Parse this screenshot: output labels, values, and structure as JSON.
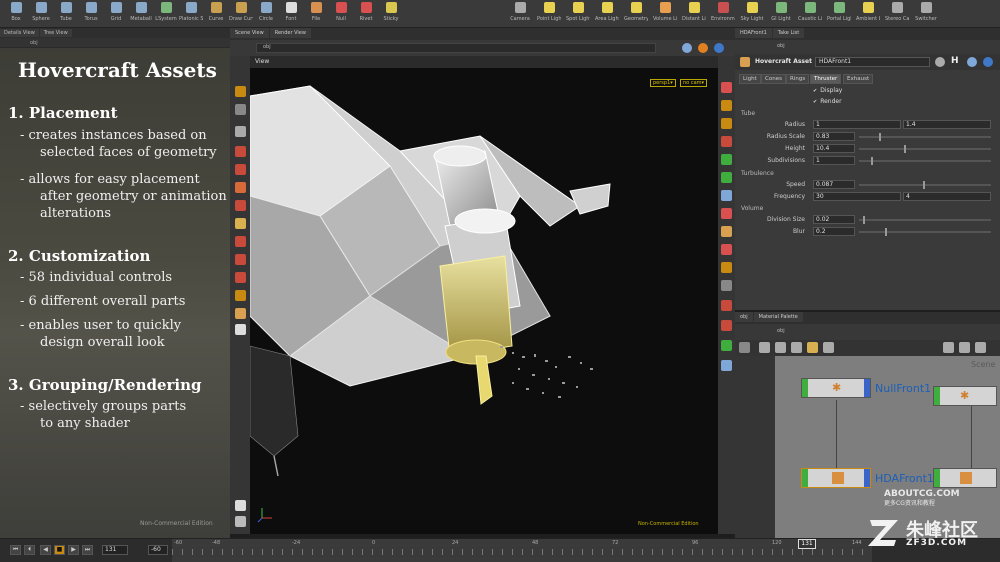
{
  "shelf": {
    "left_tools": [
      {
        "label": "Box",
        "icon": "box-icon",
        "color": "#8aa8c8"
      },
      {
        "label": "Sphere",
        "icon": "sphere-icon",
        "color": "#8aa8c8"
      },
      {
        "label": "Tube",
        "icon": "tube-icon",
        "color": "#8aa8c8"
      },
      {
        "label": "Torus",
        "icon": "torus-icon",
        "color": "#8aa8c8"
      },
      {
        "label": "Grid",
        "icon": "grid-icon",
        "color": "#8aa8c8"
      },
      {
        "label": "Metaball",
        "icon": "metaball-icon",
        "color": "#8aa8c8"
      },
      {
        "label": "LSystem",
        "icon": "lsystem-icon",
        "color": "#7cb87c"
      },
      {
        "label": "Platonic S...",
        "icon": "platonic-icon",
        "color": "#8aa8c8"
      },
      {
        "label": "Curve",
        "icon": "curve-icon",
        "color": "#c8a050"
      },
      {
        "label": "Draw Curve",
        "icon": "draw-curve-icon",
        "color": "#c8a050"
      },
      {
        "label": "Circle",
        "icon": "circle-icon",
        "color": "#8aa8c8"
      },
      {
        "label": "Font",
        "icon": "font-icon",
        "color": "#dddddd"
      },
      {
        "label": "File",
        "icon": "file-icon",
        "color": "#d89050"
      },
      {
        "label": "Null",
        "icon": "null-icon",
        "color": "#d85050"
      },
      {
        "label": "Rivet",
        "icon": "rivet-icon",
        "color": "#d85050"
      },
      {
        "label": "Sticky",
        "icon": "sticky-icon",
        "color": "#d8c850"
      }
    ],
    "right_tools": [
      {
        "label": "Camera",
        "icon": "camera-icon",
        "color": "#aaaaaa"
      },
      {
        "label": "Point Light",
        "icon": "point-light-icon",
        "color": "#e8d050"
      },
      {
        "label": "Spot Light",
        "icon": "spot-light-icon",
        "color": "#e8d050"
      },
      {
        "label": "Area Light",
        "icon": "area-light-icon",
        "color": "#e8d050"
      },
      {
        "label": "Geometry",
        "icon": "geometry-light-icon",
        "color": "#e8d050"
      },
      {
        "label": "Volume Li...",
        "icon": "volume-light-icon",
        "color": "#e8a050"
      },
      {
        "label": "Distant Li...",
        "icon": "distant-light-icon",
        "color": "#e8d050"
      },
      {
        "label": "Environm...",
        "icon": "environment-light-icon",
        "color": "#c85050"
      },
      {
        "label": "Sky Light",
        "icon": "sky-light-icon",
        "color": "#e8d050"
      },
      {
        "label": "GI Light",
        "icon": "gi-light-icon",
        "color": "#7cb87c"
      },
      {
        "label": "Caustic Li...",
        "icon": "caustic-light-icon",
        "color": "#7cb87c"
      },
      {
        "label": "Portal Light",
        "icon": "portal-light-icon",
        "color": "#7cb87c"
      },
      {
        "label": "Ambient L...",
        "icon": "ambient-light-icon",
        "color": "#e8d050"
      },
      {
        "label": "Stereo Ca...",
        "icon": "stereo-camera-icon",
        "color": "#aaaaaa"
      },
      {
        "label": "Switcher",
        "icon": "switcher-icon",
        "color": "#aaaaaa"
      }
    ]
  },
  "left_panel": {
    "tabs": [
      "Details View",
      "Tree View"
    ],
    "path": "obj",
    "title": "Hovercraft Assets",
    "sections": [
      {
        "heading": "1. Placement",
        "bullets": [
          {
            "line1": "- creates instances based on",
            "line2": "selected faces of geometry"
          },
          {
            "line1": "- allows for easy placement",
            "line2": "after geometry or animation"
          },
          {
            "line1": "",
            "line2": "alterations"
          }
        ]
      },
      {
        "heading": "2. Customization",
        "bullets": [
          {
            "line1": "- 58 individual controls",
            "line2": ""
          },
          {
            "line1": "- 6 different overall parts",
            "line2": ""
          },
          {
            "line1": "- enables user to quickly",
            "line2": "design overall look"
          }
        ]
      },
      {
        "heading": "3. Grouping/Rendering",
        "bullets": [
          {
            "line1": "- selectively groups parts",
            "line2": "to any shader"
          }
        ]
      }
    ],
    "edition": "Non-Commercial Edition"
  },
  "viewport": {
    "tabs": [
      "Scene View",
      "Render View"
    ],
    "path": "obj",
    "label": "View",
    "persp_button": "persp1▾",
    "cam_button": "no cam▾",
    "edition": "Non-Commercial Edition"
  },
  "params": {
    "tabs": [
      "HDAFront1",
      "Take List"
    ],
    "path": "obj",
    "asset_type": "Hovercraft Asset",
    "asset_name": "HDAFront1",
    "param_tabs": [
      "Light",
      "Cones",
      "Rings",
      "Thruster",
      "Exhaust"
    ],
    "active_tab": "Thruster",
    "display_label": "Display",
    "render_label": "Render",
    "tube_group": "Tube",
    "turbulence_group": "Turbulence",
    "volume_group": "Volume",
    "radius_label": "Radius",
    "radius_1": "1",
    "radius_2": "1.4",
    "radius_scale_label": "Radius Scale",
    "radius_scale": "0.83",
    "height_label": "Height",
    "height": "10.4",
    "subdivisions_label": "Subdivisions",
    "subdivisions": "1",
    "speed_label": "Speed",
    "speed": "0.087",
    "frequency_label": "Frequency",
    "frequency_1": "30",
    "frequency_2": "4",
    "division_size_label": "Division Size",
    "division_size": "0.02",
    "blur_label": "Blur",
    "blur": "0.2",
    "accent_color": "#c88a10"
  },
  "network": {
    "tabs": [
      "obj",
      "Material Palette"
    ],
    "path": "obj",
    "scene_label": "Scene",
    "nodes": [
      {
        "name": "NullFront1"
      },
      {
        "name": "HDAFront1"
      }
    ]
  },
  "timeline": {
    "current_frame": "131",
    "start_field": "131",
    "offset_field": "-60",
    "ticks": [
      "-60",
      "-48",
      "-24",
      "0",
      "24",
      "48",
      "72",
      "96",
      "120",
      "144"
    ],
    "marker": "131"
  },
  "watermarks": {
    "site1": "ABOUTCG.COM",
    "site1_sub": "更多CG资讯和教程",
    "site2": "朱峰社区",
    "site2_sub": "ZF3D.COM"
  }
}
